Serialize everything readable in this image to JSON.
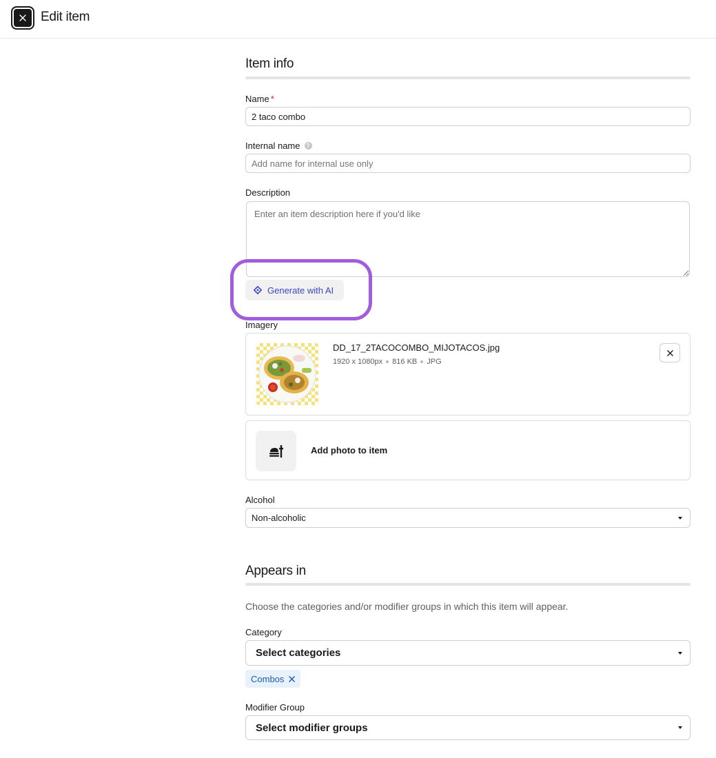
{
  "header": {
    "title": "Edit item"
  },
  "item_info": {
    "section_title": "Item info",
    "name": {
      "label": "Name",
      "required_mark": "*",
      "value": "2 taco combo"
    },
    "internal_name": {
      "label": "Internal name",
      "help_glyph": "?",
      "placeholder": "Add name for internal use only"
    },
    "description": {
      "label": "Description",
      "placeholder": "Enter an item description here if you'd like"
    },
    "generate_ai_label": "Generate with AI",
    "imagery": {
      "label": "Imagery",
      "file": {
        "name": "DD_17_2TACOCOMBO_MIJOTACOS.jpg",
        "dimensions": "1920 x 1080px",
        "size": "816 KB",
        "format": "JPG"
      },
      "add_photo_label": "Add photo to item"
    },
    "alcohol": {
      "label": "Alcohol",
      "value": "Non-alcoholic"
    }
  },
  "appears_in": {
    "section_title": "Appears in",
    "helper": "Choose the categories and/or modifier groups in which this item will appear.",
    "category": {
      "label": "Category",
      "placeholder": "Select categories",
      "chips": [
        "Combos"
      ]
    },
    "modifier_group": {
      "label": "Modifier Group",
      "placeholder": "Select modifier groups"
    }
  },
  "colors": {
    "accent_highlight": "#a25ddc",
    "ai_text": "#3b46c4",
    "chip_bg": "#e8f1fc",
    "chip_text": "#1a5bb8",
    "required": "#d0213b"
  }
}
